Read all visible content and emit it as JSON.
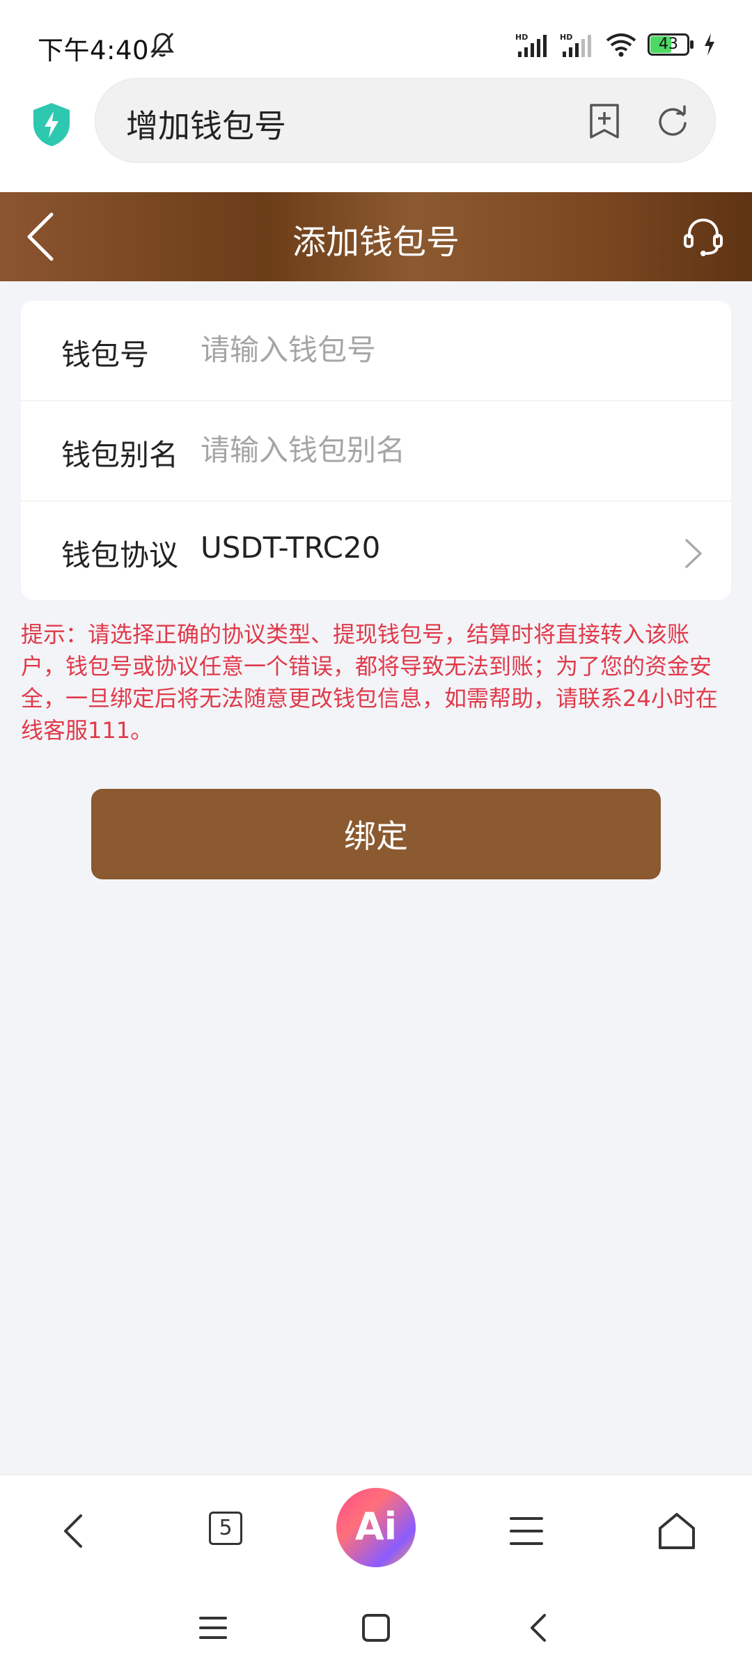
{
  "status_bar": {
    "time": "下午4:40",
    "battery": "43"
  },
  "browser": {
    "url_title": "增加钱包号",
    "tabs_count": "5",
    "ai_label": "Ai"
  },
  "header": {
    "title": "添加钱包号"
  },
  "form": {
    "wallet_number": {
      "label": "钱包号",
      "placeholder": "请输入钱包号",
      "value": ""
    },
    "wallet_alias": {
      "label": "钱包别名",
      "placeholder": "请输入钱包别名",
      "value": ""
    },
    "wallet_protocol": {
      "label": "钱包协议",
      "value": "USDT-TRC20"
    }
  },
  "notice": "提示：请选择正确的协议类型、提现钱包号，结算时将直接转入该账户，钱包号或协议任意一个错误，都将导致无法到账；为了您的资金安全，一旦绑定后将无法随意更改钱包信息，如需帮助，请联系24小时在线客服111。",
  "bind_button": "绑定",
  "colors": {
    "accent_brown": "#8b5a30",
    "notice_red": "#e0394a",
    "shield_teal": "#2ec7b0"
  }
}
